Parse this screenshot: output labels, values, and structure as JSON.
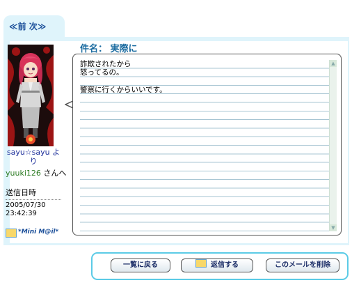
{
  "nav": {
    "prev_next": "≪前 次≫"
  },
  "mail": {
    "subject_label": "件名：",
    "subject": "実際に",
    "body_lines": [
      "詐欺されたから",
      "怒ってるの。",
      "",
      "警察に行くからいいです。"
    ]
  },
  "sender": {
    "name": "sayu☆sayu より"
  },
  "recipient": {
    "id": "yuuki126",
    "suffix": " さんへ"
  },
  "sent": {
    "label": "送信日時",
    "date": "2005/07/30",
    "time": "23:42:39"
  },
  "brand": {
    "label": "*Mini M@il*"
  },
  "actions": {
    "back_to_list": "一覧に戻る",
    "reply": "返信する",
    "delete": "このメールを削除"
  },
  "colors": {
    "accent": "#1a6ba0",
    "panel_bg": "#dff4fb",
    "button_bar_border": "#5bcbe6"
  }
}
